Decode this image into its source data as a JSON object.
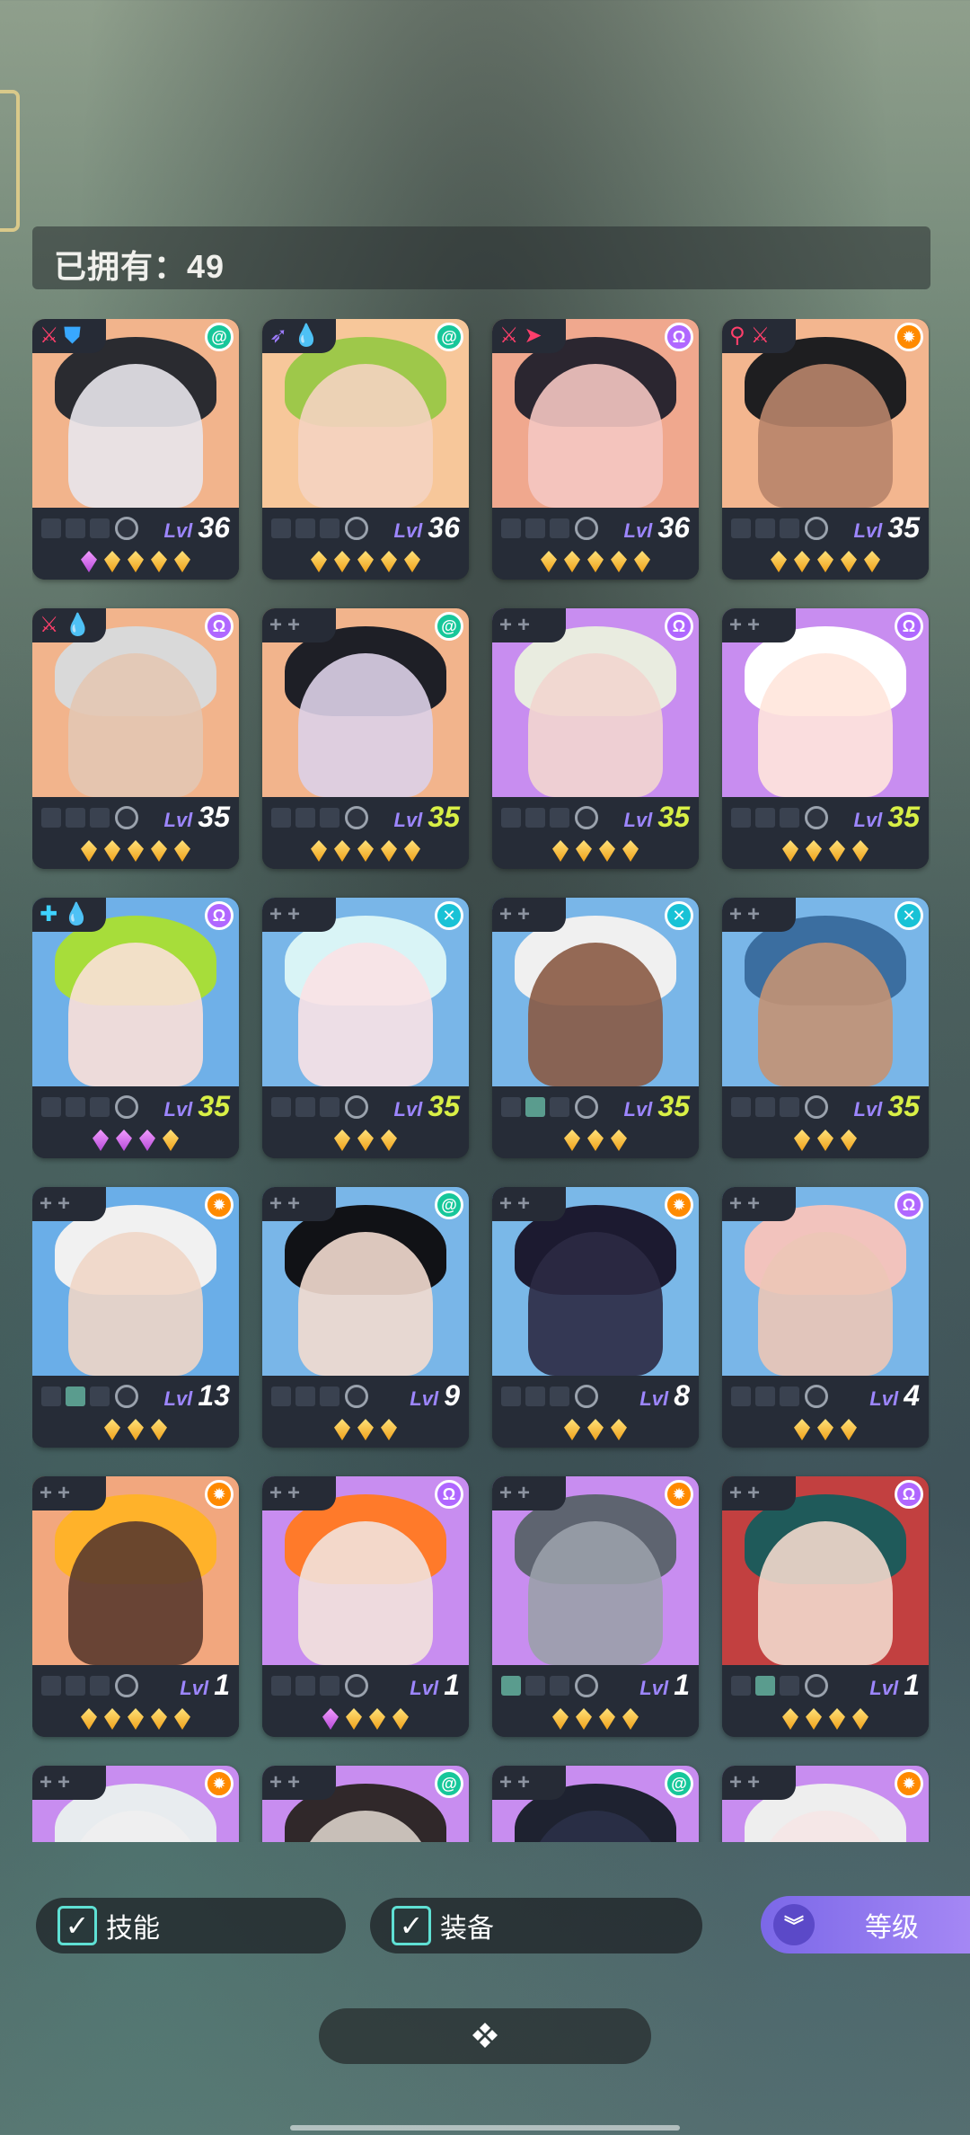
{
  "header": {
    "owned_label": "已拥有：49"
  },
  "cards": [
    {
      "bg": "#f2b48c",
      "hair": "#2a2b30",
      "face": "#e8e6ec",
      "tags": [
        {
          "g": "⚔",
          "c": "#ff3f6b"
        },
        {
          "g": "⛊",
          "c": "#38a8ff"
        }
      ],
      "elem": "swirl",
      "elemColor": "#17c79a",
      "lvl": "36",
      "yellow": false,
      "slots": [
        "",
        "",
        ""
      ],
      "gems": [
        "purple",
        "gold",
        "gold",
        "gold",
        "gold"
      ]
    },
    {
      "bg": "#f7c79a",
      "hair": "#9ec84a",
      "face": "#f4d3c1",
      "tags": [
        {
          "g": "➶",
          "c": "#9d7cff"
        },
        {
          "g": "💧",
          "c": "#2ab9ff"
        }
      ],
      "elem": "swirl",
      "elemColor": "#17c79a",
      "lvl": "36",
      "yellow": false,
      "slots": [
        "",
        "",
        ""
      ],
      "gems": [
        "gold",
        "gold",
        "gold",
        "gold",
        "gold"
      ]
    },
    {
      "bg": "#f0a88e",
      "hair": "#2b2630",
      "face": "#f4c6c2",
      "tags": [
        {
          "g": "⚔",
          "c": "#ff3f6b"
        },
        {
          "g": "➤",
          "c": "#ff3f6b"
        }
      ],
      "elem": "omega",
      "elemColor": "#b067ff",
      "lvl": "36",
      "yellow": false,
      "slots": [
        "",
        "",
        ""
      ],
      "gems": [
        "gold",
        "gold",
        "gold",
        "gold",
        "gold"
      ]
    },
    {
      "bg": "#f3b68f",
      "hair": "#1e1e20",
      "face": "#b8846a",
      "tags": [
        {
          "g": "⚲",
          "c": "#ff3f6b"
        },
        {
          "g": "⚔",
          "c": "#ff3f6b"
        }
      ],
      "elem": "sun",
      "elemColor": "#ff8a00",
      "lvl": "35",
      "yellow": false,
      "slots": [
        "",
        "",
        ""
      ],
      "gems": [
        "gold",
        "gold",
        "gold",
        "gold",
        "gold"
      ]
    },
    {
      "bg": "#f2b48c",
      "hair": "#d9d9d9",
      "face": "#e3c7b2",
      "tags": [
        {
          "g": "⚔",
          "c": "#ff3f6b"
        },
        {
          "g": "💧",
          "c": "#2ab9ff"
        }
      ],
      "elem": "omega",
      "elemColor": "#b067ff",
      "lvl": "35",
      "yellow": false,
      "slots": [
        "",
        "",
        ""
      ],
      "gems": [
        "gold",
        "gold",
        "gold",
        "gold",
        "gold"
      ]
    },
    {
      "bg": "#f2b48c",
      "hair": "#1e1f26",
      "face": "#dcd0e8",
      "tags": [
        {
          "g": "+",
          "c": "#8c93a0"
        },
        {
          "g": "+",
          "c": "#8c93a0"
        }
      ],
      "elem": "swirl",
      "elemColor": "#17c79a",
      "lvl": "35",
      "yellow": true,
      "slots": [
        "",
        "",
        ""
      ],
      "gems": [
        "gold",
        "gold",
        "gold",
        "gold",
        "gold"
      ]
    },
    {
      "bg": "#c88df0",
      "hair": "#e9ece0",
      "face": "#f2d6cf",
      "tags": [
        {
          "g": "+",
          "c": "#8c93a0"
        },
        {
          "g": "+",
          "c": "#8c93a0"
        }
      ],
      "elem": "omega",
      "elemColor": "#b067ff",
      "lvl": "35",
      "yellow": true,
      "slots": [
        "",
        "",
        ""
      ],
      "gems": [
        "gold",
        "gold",
        "gold",
        "gold"
      ]
    },
    {
      "bg": "#c88df0",
      "hair": "#ffffff",
      "face": "#ffe6dc",
      "tags": [
        {
          "g": "+",
          "c": "#8c93a0"
        },
        {
          "g": "+",
          "c": "#8c93a0"
        }
      ],
      "elem": "omega",
      "elemColor": "#b067ff",
      "lvl": "35",
      "yellow": true,
      "slots": [
        "",
        "",
        ""
      ],
      "gems": [
        "gold",
        "gold",
        "gold",
        "gold"
      ]
    },
    {
      "bg": "#6fb0e8",
      "hair": "#a7dd3a",
      "face": "#fbe0d8",
      "tags": [
        {
          "g": "✚",
          "c": "#3ed2ff"
        },
        {
          "g": "💧",
          "c": "#2ab9ff"
        }
      ],
      "elem": "omega",
      "elemColor": "#b067ff",
      "lvl": "35",
      "yellow": true,
      "slots": [
        "",
        "",
        ""
      ],
      "gems": [
        "purple",
        "purple",
        "purple",
        "gold"
      ]
    },
    {
      "bg": "#79b6e8",
      "hair": "#d9f4f6",
      "face": "#f9e2e6",
      "tags": [
        {
          "g": "+",
          "c": "#8c93a0"
        },
        {
          "g": "+",
          "c": "#8c93a0"
        }
      ],
      "elem": "cross",
      "elemColor": "#18c2d6",
      "lvl": "35",
      "yellow": true,
      "slots": [
        "",
        "",
        ""
      ],
      "gems": [
        "gold",
        "gold",
        "gold"
      ]
    },
    {
      "bg": "#79b6e8",
      "hair": "#f0f0f0",
      "face": "#8a5a44",
      "tags": [
        {
          "g": "+",
          "c": "#8c93a0"
        },
        {
          "g": "+",
          "c": "#8c93a0"
        }
      ],
      "elem": "cross",
      "elemColor": "#18c2d6",
      "lvl": "35",
      "yellow": true,
      "slots": [
        "",
        "teal",
        ""
      ],
      "gems": [
        "gold",
        "gold",
        "gold"
      ]
    },
    {
      "bg": "#79b6e8",
      "hair": "#3b6ea0",
      "face": "#c49273",
      "tags": [
        {
          "g": "+",
          "c": "#8c93a0"
        },
        {
          "g": "+",
          "c": "#8c93a0"
        }
      ],
      "elem": "cross",
      "elemColor": "#18c2d6",
      "lvl": "35",
      "yellow": true,
      "slots": [
        "",
        "",
        ""
      ],
      "gems": [
        "gold",
        "gold",
        "gold"
      ]
    },
    {
      "bg": "#6aaee8",
      "hair": "#f1f1f1",
      "face": "#f0d6c6",
      "tags": [
        {
          "g": "+",
          "c": "#8c93a0"
        },
        {
          "g": "+",
          "c": "#8c93a0"
        }
      ],
      "elem": "sun",
      "elemColor": "#ff8a00",
      "lvl": "13",
      "yellow": false,
      "slots": [
        "",
        "teal",
        ""
      ],
      "gems": [
        "gold",
        "gold",
        "gold"
      ]
    },
    {
      "bg": "#79b6e8",
      "hair": "#111216",
      "face": "#f3dccf",
      "tags": [
        {
          "g": "+",
          "c": "#8c93a0"
        },
        {
          "g": "+",
          "c": "#8c93a0"
        }
      ],
      "elem": "swirl",
      "elemColor": "#17c79a",
      "lvl": "9",
      "yellow": false,
      "slots": [
        "",
        "",
        ""
      ],
      "gems": [
        "gold",
        "gold",
        "gold"
      ]
    },
    {
      "bg": "#7ab8e8",
      "hair": "#1c1a30",
      "face": "#2c2a44",
      "tags": [
        {
          "g": "+",
          "c": "#8c93a0"
        },
        {
          "g": "+",
          "c": "#8c93a0"
        }
      ],
      "elem": "sun",
      "elemColor": "#ff8a00",
      "lvl": "8",
      "yellow": false,
      "slots": [
        "",
        "",
        ""
      ],
      "gems": [
        "gold",
        "gold",
        "gold"
      ]
    },
    {
      "bg": "#79b6e8",
      "hair": "#f2c3bd",
      "face": "#ecc6b6",
      "tags": [
        {
          "g": "+",
          "c": "#8c93a0"
        },
        {
          "g": "+",
          "c": "#8c93a0"
        }
      ],
      "elem": "omega",
      "elemColor": "#b067ff",
      "lvl": "4",
      "yellow": false,
      "slots": [
        "",
        "",
        ""
      ],
      "gems": [
        "gold",
        "gold",
        "gold"
      ]
    },
    {
      "bg": "#f2a77e",
      "hair": "#ffb22a",
      "face": "#5a3a2e",
      "tags": [
        {
          "g": "+",
          "c": "#8c93a0"
        },
        {
          "g": "+",
          "c": "#8c93a0"
        }
      ],
      "elem": "sun",
      "elemColor": "#ff8a00",
      "lvl": "1",
      "yellow": false,
      "slots": [
        "",
        "",
        ""
      ],
      "gems": [
        "gold",
        "gold",
        "gold",
        "gold",
        "gold"
      ]
    },
    {
      "bg": "#c88df0",
      "hair": "#ff7a2a",
      "face": "#f2e2dc",
      "tags": [
        {
          "g": "+",
          "c": "#8c93a0"
        },
        {
          "g": "+",
          "c": "#8c93a0"
        }
      ],
      "elem": "omega",
      "elemColor": "#b067ff",
      "lvl": "1",
      "yellow": false,
      "slots": [
        "",
        "",
        ""
      ],
      "gems": [
        "purple",
        "gold",
        "gold",
        "gold"
      ]
    },
    {
      "bg": "#c88df0",
      "hair": "#5e6470",
      "face": "#9aa0aa",
      "tags": [
        {
          "g": "+",
          "c": "#8c93a0"
        },
        {
          "g": "+",
          "c": "#8c93a0"
        }
      ],
      "elem": "sun",
      "elemColor": "#ff8a00",
      "lvl": "1",
      "yellow": false,
      "slots": [
        "teal",
        "",
        ""
      ],
      "gems": [
        "gold",
        "gold",
        "gold",
        "gold"
      ]
    },
    {
      "bg": "#c24040",
      "hair": "#1f5a5a",
      "face": "#f2d8cc",
      "tags": [
        {
          "g": "+",
          "c": "#8c93a0"
        },
        {
          "g": "+",
          "c": "#8c93a0"
        }
      ],
      "elem": "omega",
      "elemColor": "#b067ff",
      "lvl": "1",
      "yellow": false,
      "slots": [
        "",
        "teal",
        ""
      ],
      "gems": [
        "gold",
        "gold",
        "gold",
        "gold"
      ]
    },
    {
      "bg": "#c88df0",
      "hair": "#e8ecef",
      "face": "#f0f0f0",
      "tags": [
        {
          "g": "+",
          "c": "#8c93a0"
        },
        {
          "g": "+",
          "c": "#8c93a0"
        }
      ],
      "elem": "sun",
      "elemColor": "#ff8a00",
      "lvl": "",
      "yellow": false,
      "slots": [
        "",
        "",
        ""
      ],
      "gems": []
    },
    {
      "bg": "#c88df0",
      "hair": "#30282a",
      "face": "#d9cfc8",
      "tags": [
        {
          "g": "+",
          "c": "#8c93a0"
        },
        {
          "g": "+",
          "c": "#8c93a0"
        }
      ],
      "elem": "swirl",
      "elemColor": "#17c79a",
      "lvl": "",
      "yellow": false,
      "slots": [
        "",
        "",
        ""
      ],
      "gems": []
    },
    {
      "bg": "#c88df0",
      "hair": "#1e2230",
      "face": "#2a3048",
      "tags": [
        {
          "g": "+",
          "c": "#8c93a0"
        },
        {
          "g": "+",
          "c": "#8c93a0"
        }
      ],
      "elem": "swirl",
      "elemColor": "#17c79a",
      "lvl": "",
      "yellow": false,
      "slots": [
        "",
        "",
        ""
      ],
      "gems": []
    },
    {
      "bg": "#c88df0",
      "hair": "#eeeeee",
      "face": "#f5e6e6",
      "tags": [
        {
          "g": "+",
          "c": "#8c93a0"
        },
        {
          "g": "+",
          "c": "#8c93a0"
        }
      ],
      "elem": "sun",
      "elemColor": "#ff8a00",
      "lvl": "",
      "yellow": false,
      "slots": [
        "",
        "",
        ""
      ],
      "gems": []
    }
  ],
  "level_label": "Lvl",
  "filters": {
    "skill": {
      "label": "技能",
      "checked": true
    },
    "equip": {
      "label": "装备",
      "checked": true
    }
  },
  "sort": {
    "label": "等级"
  },
  "icons": {
    "expand": "chevrons-expand-icon",
    "sort": "double-chevron-down-icon",
    "check": "checkmark-icon"
  }
}
